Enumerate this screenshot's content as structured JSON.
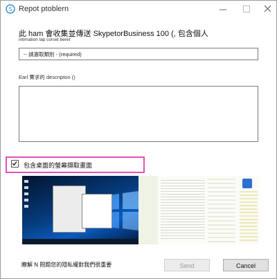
{
  "window": {
    "title": "Repot ptoblern"
  },
  "form": {
    "heading": "此 ham 會收集並傳送 SkypetorBusiness 100 (, 包含個人",
    "subnote": "intimation lap corset beret",
    "category_select": {
      "selected": "-- 請選取類別 - (required)"
    },
    "description_label": "Earl 賽求的 descnpton ()",
    "description_value": "",
    "screenshot_checkbox": {
      "label": "包含桌面的螢幕擷取畫面",
      "checked": true
    }
  },
  "footer": {
    "text": "瞭解 N 問題您的隱私權對我們很重要",
    "send_label": "Send",
    "cancel_label": "Cancel"
  },
  "icons": [
    "skype-icon",
    "minimize-icon",
    "maximize-icon",
    "close-icon",
    "checkmark-icon"
  ],
  "colors": {
    "highlight": "#e54fbf",
    "desktop_blue": "#0a5bbf"
  }
}
